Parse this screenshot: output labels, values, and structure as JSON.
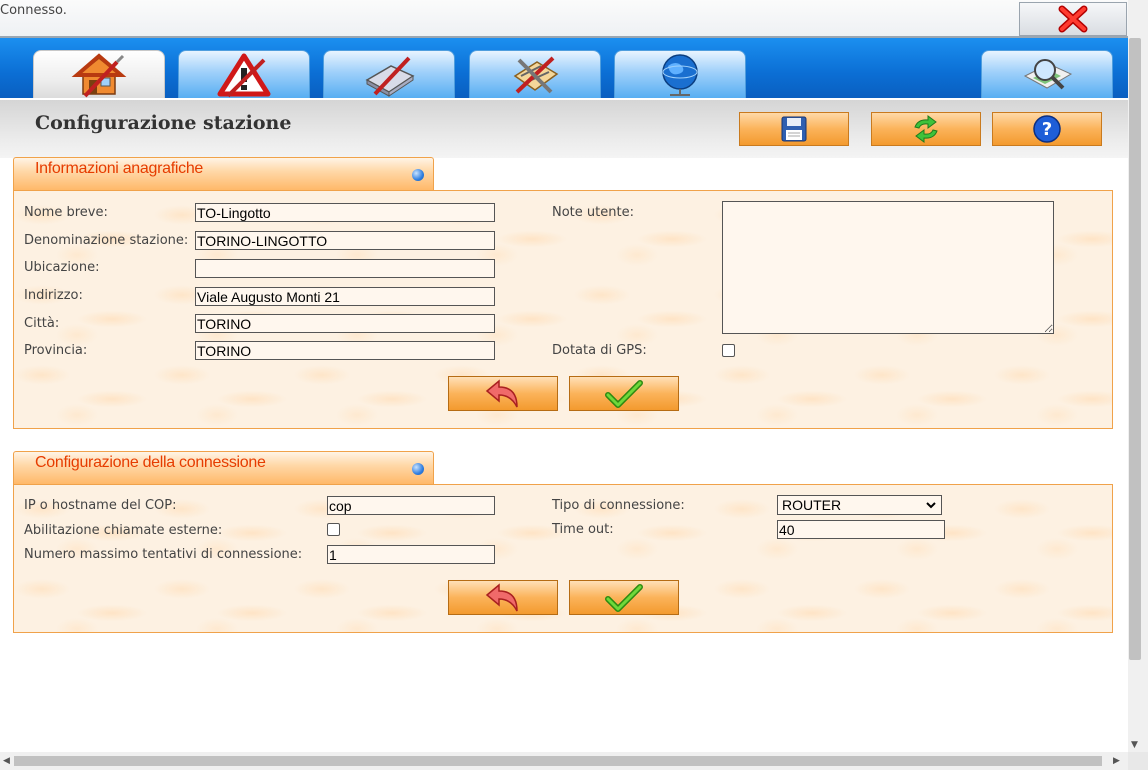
{
  "status": {
    "text": "Connesso."
  },
  "nav": {
    "tabs": [
      {
        "icon": "home-tools-icon",
        "active": true
      },
      {
        "icon": "warning-tools-icon",
        "active": false
      },
      {
        "icon": "disk-tools-icon",
        "active": false
      },
      {
        "icon": "settings-tools-icon",
        "active": false
      },
      {
        "icon": "network-globe-icon",
        "active": false
      },
      {
        "icon": "search-map-icon",
        "active": false
      }
    ]
  },
  "header": {
    "title": "Configurazione stazione",
    "buttons": [
      "save-icon",
      "refresh-icon",
      "help-icon"
    ]
  },
  "anagrafica": {
    "title": "Informazioni anagrafiche",
    "nome_breve_label": "Nome breve:",
    "nome_breve_value": "TO-Lingotto",
    "denominazione_label": "Denominazione stazione:",
    "denominazione_value": "TORINO-LINGOTTO",
    "ubicazione_label": "Ubicazione:",
    "ubicazione_value": "",
    "indirizzo_label": "Indirizzo:",
    "indirizzo_value": "Viale Augusto Monti 21",
    "citta_label": "Città:",
    "citta_value": "TORINO",
    "provincia_label": "Provincia:",
    "provincia_value": "TORINO",
    "note_label": "Note utente:",
    "note_value": "",
    "gps_label": "Dotata di GPS:",
    "gps_checked": false
  },
  "connessione": {
    "title": "Configurazione della connessione",
    "ip_label": "IP o hostname del COP:",
    "ip_value": "cop",
    "abilitazione_label": "Abilitazione chiamate esterne:",
    "abilitazione_checked": false,
    "tentativi_label": "Numero massimo tentativi di connessione:",
    "tentativi_value": "1",
    "tipo_label": "Tipo di connessione:",
    "tipo_value": "ROUTER",
    "timeout_label": "Time out:",
    "timeout_value": "40"
  },
  "colors": {
    "nav_blue": "#0b6ed4",
    "section_title": "#e63c00",
    "button_orange": "#f39a2e",
    "section_border": "#f0a24a"
  }
}
